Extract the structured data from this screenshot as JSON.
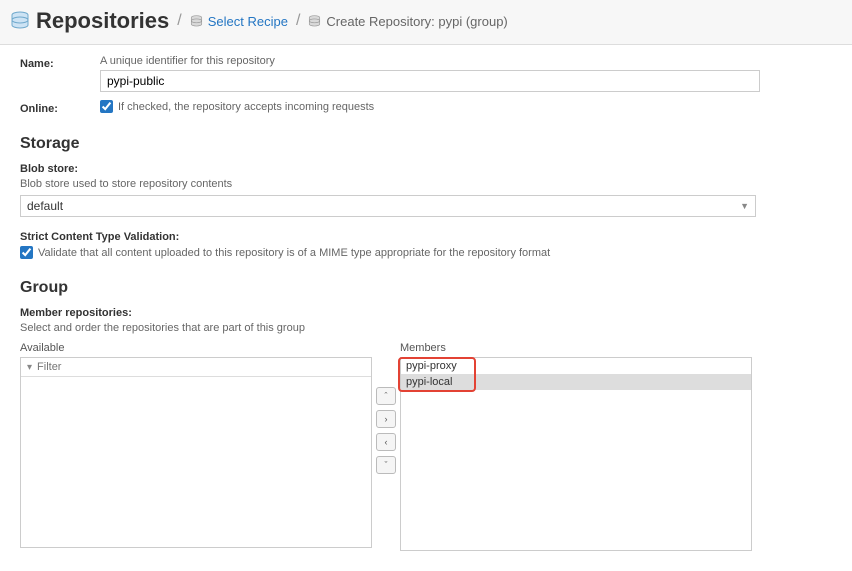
{
  "breadcrumb": {
    "title": "Repositories",
    "select_recipe": "Select Recipe",
    "current": "Create Repository: pypi (group)"
  },
  "name": {
    "label": "Name:",
    "help": "A unique identifier for this repository",
    "value": "pypi-public"
  },
  "online": {
    "label": "Online:",
    "help": "If checked, the repository accepts incoming requests"
  },
  "storage": {
    "heading": "Storage",
    "blob_label": "Blob store:",
    "blob_help": "Blob store used to store repository contents",
    "blob_value": "default",
    "strict_label": "Strict Content Type Validation:",
    "strict_help": "Validate that all content uploaded to this repository is of a MIME type appropriate for the repository format"
  },
  "group": {
    "heading": "Group",
    "member_label": "Member repositories:",
    "member_help": "Select and order the repositories that are part of this group",
    "available_label": "Available",
    "members_label": "Members",
    "filter_placeholder": "Filter",
    "buttons": {
      "up": "ˆ",
      "right": "›",
      "left": "‹",
      "down": "ˇ"
    },
    "members": [
      "pypi-proxy",
      "pypi-local"
    ]
  }
}
